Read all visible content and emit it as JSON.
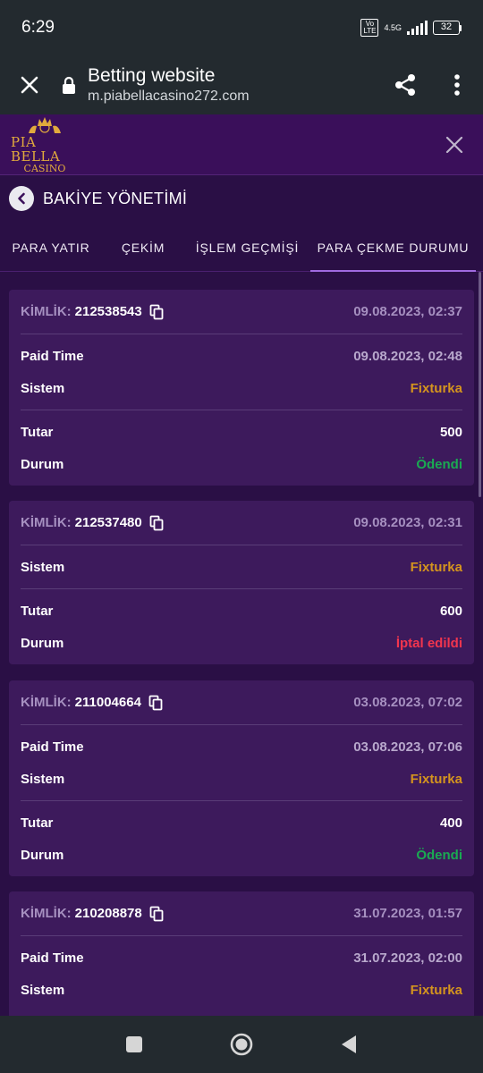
{
  "status_bar": {
    "time": "6:29",
    "volte_line1": "Vo",
    "volte_line2": "LTE",
    "network": "4.5G",
    "battery": "32"
  },
  "browser": {
    "title": "Betting website",
    "url": "m.piabellacasino272.com"
  },
  "site": {
    "logo_main": "PIA BELLA",
    "logo_sub": "CASINO"
  },
  "page": {
    "title": "BAKİYE YÖNETİMİ"
  },
  "tabs": [
    {
      "label": "PARA YATIR",
      "active": false
    },
    {
      "label": "ÇEKİM",
      "active": false
    },
    {
      "label": "İŞLEM GEÇMİŞİ",
      "active": false
    },
    {
      "label": "PARA ÇEKME DURUMU",
      "active": true
    }
  ],
  "labels": {
    "id": "KİMLİK:",
    "paid_time": "Paid Time",
    "system": "Sistem",
    "amount": "Tutar",
    "status": "Durum"
  },
  "transactions": [
    {
      "id": "212538543",
      "date": "09.08.2023, 02:37",
      "paid_time": "09.08.2023, 02:48",
      "system": "Fixturka",
      "amount": "500",
      "status": "Ödendi"
    },
    {
      "id": "212537480",
      "date": "09.08.2023, 02:31",
      "system": "Fixturka",
      "amount": "600",
      "status": "İptal edildi"
    },
    {
      "id": "211004664",
      "date": "03.08.2023, 07:02",
      "paid_time": "03.08.2023, 07:06",
      "system": "Fixturka",
      "amount": "400",
      "status": "Ödendi"
    },
    {
      "id": "210208878",
      "date": "31.07.2023, 01:57",
      "paid_time": "31.07.2023, 02:00",
      "system": "Fixturka"
    }
  ],
  "colors": {
    "background": "#2a0f45",
    "card": "#3d1a5c",
    "system": "#d4941e",
    "paid": "#1aaa52",
    "cancelled": "#f2354e",
    "logo_gold": "#e1aa3d"
  }
}
